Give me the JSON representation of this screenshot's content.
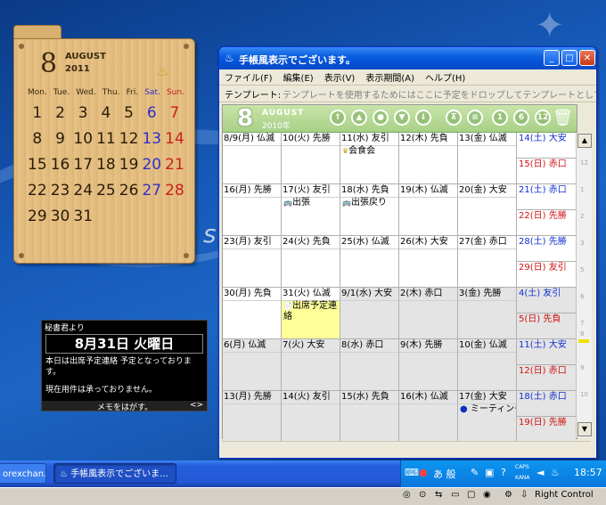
{
  "widget": {
    "day": "8",
    "month": "AUGUST",
    "year": "2011",
    "weekday_headers": [
      "Mon.",
      "Tue.",
      "Wed.",
      "Thu.",
      "Fri.",
      "Sat.",
      "Sun."
    ],
    "weeks": [
      [
        "1",
        "2",
        "3",
        "4",
        "5",
        "6",
        "7"
      ],
      [
        "8",
        "9",
        "10",
        "11",
        "12",
        "13",
        "14"
      ],
      [
        "15",
        "16",
        "17",
        "18",
        "19",
        "20",
        "21"
      ],
      [
        "22",
        "23",
        "24",
        "25",
        "26",
        "27",
        "28"
      ],
      [
        "29",
        "30",
        "31",
        "",
        "",
        "",
        ""
      ]
    ]
  },
  "secretary": {
    "title": "秘書君より",
    "date": "8月31日 火曜日",
    "line1": "本日は出席予定連絡 予定となっております。",
    "line2": "現在用件は承っておりません。",
    "footer": "メモをはがす。",
    "footer_nav": "<>"
  },
  "window": {
    "title": "手帳風表示でございます。",
    "menu": [
      "ファイル(F)",
      "編集(E)",
      "表示(V)",
      "表示期間(A)",
      "ヘルプ(H)"
    ],
    "template_label": "テンプレート:",
    "template_hint": "テンプレートを使用するためにはここに予定をドロップしてテンプレートとして登録...",
    "cal_day": "8",
    "cal_month": "AUGUST",
    "cal_year": "2010年",
    "nav_buttons": [
      "⇑",
      "▲",
      "●",
      "▼",
      "⇓",
      "⊼",
      "≡",
      "1",
      "6",
      "12"
    ]
  },
  "calendar": {
    "weeks": [
      {
        "days": [
          {
            "label": "8/9(月) 仏滅",
            "events": [],
            "gray": false
          },
          {
            "label": "10(火) 先勝",
            "events": [],
            "gray": false
          },
          {
            "label": "11(水) 友引",
            "events": [
              "会食会"
            ],
            "gray": false
          },
          {
            "label": "12(木) 先負",
            "events": [],
            "gray": false
          },
          {
            "label": "13(金) 仏滅",
            "events": [],
            "gray": false
          }
        ],
        "sat": "14(土) 大安",
        "sun": "15(日) 赤口"
      },
      {
        "days": [
          {
            "label": "16(月) 先勝",
            "events": [],
            "gray": false
          },
          {
            "label": "17(火) 友引",
            "events": [
              "出張"
            ],
            "gray": false
          },
          {
            "label": "18(水) 先負",
            "events": [
              "出張戻り"
            ],
            "gray": false
          },
          {
            "label": "19(木) 仏滅",
            "events": [],
            "gray": false
          },
          {
            "label": "20(金) 大安",
            "events": [],
            "gray": false
          }
        ],
        "sat": "21(土) 赤口",
        "sun": "22(日) 先勝"
      },
      {
        "days": [
          {
            "label": "23(月) 友引",
            "events": [],
            "gray": false
          },
          {
            "label": "24(火) 先負",
            "events": [],
            "gray": false
          },
          {
            "label": "25(水) 仏滅",
            "events": [],
            "gray": false
          },
          {
            "label": "26(木) 大安",
            "events": [],
            "gray": false
          },
          {
            "label": "27(金) 赤口",
            "events": [],
            "gray": false
          }
        ],
        "sat": "28(土) 先勝",
        "sun": "29(日) 友引"
      },
      {
        "days": [
          {
            "label": "30(月) 先負",
            "events": [],
            "gray": false
          },
          {
            "label": "31(火) 仏滅",
            "events": [
              "出席予定連絡"
            ],
            "gray": false,
            "today": true
          },
          {
            "label": "9/1(水) 大安",
            "events": [],
            "gray": true
          },
          {
            "label": "2(木) 赤口",
            "events": [],
            "gray": true
          },
          {
            "label": "3(金) 先勝",
            "events": [],
            "gray": true
          }
        ],
        "sat": "4(土) 友引",
        "sun": "5(日) 先負"
      },
      {
        "days": [
          {
            "label": "6(月) 仏滅",
            "events": [],
            "gray": true
          },
          {
            "label": "7(火) 大安",
            "events": [],
            "gray": true
          },
          {
            "label": "8(水) 赤口",
            "events": [],
            "gray": true
          },
          {
            "label": "9(木) 先勝",
            "events": [],
            "gray": true
          },
          {
            "label": "10(金) 仏滅",
            "events": [],
            "gray": true
          }
        ],
        "sat": "11(土) 大安",
        "sun": "12(日) 赤口"
      },
      {
        "days": [
          {
            "label": "13(月) 先勝",
            "events": [],
            "gray": true
          },
          {
            "label": "14(火) 友引",
            "events": [],
            "gray": true
          },
          {
            "label": "15(水) 先負",
            "events": [],
            "gray": true
          },
          {
            "label": "16(木) 仏滅",
            "events": [],
            "gray": true
          },
          {
            "label": "17(金) 大安",
            "events": [
              "ミーティング"
            ],
            "gray": true
          }
        ],
        "sat": "18(土) 赤口",
        "sun": "19(日) 先勝"
      }
    ]
  },
  "taskbar": {
    "task1": "orexchan...",
    "task2": "手帳風表示でございま...",
    "tray_ime": "あ 般",
    "caps": "CAPS",
    "kana": "KANA",
    "clock": "18:57",
    "right_control": "Right Control"
  },
  "colors": {
    "saturday": "#1030d0",
    "sunday": "#d01010",
    "today": "#ffff99",
    "header_green": "#a8d088"
  }
}
